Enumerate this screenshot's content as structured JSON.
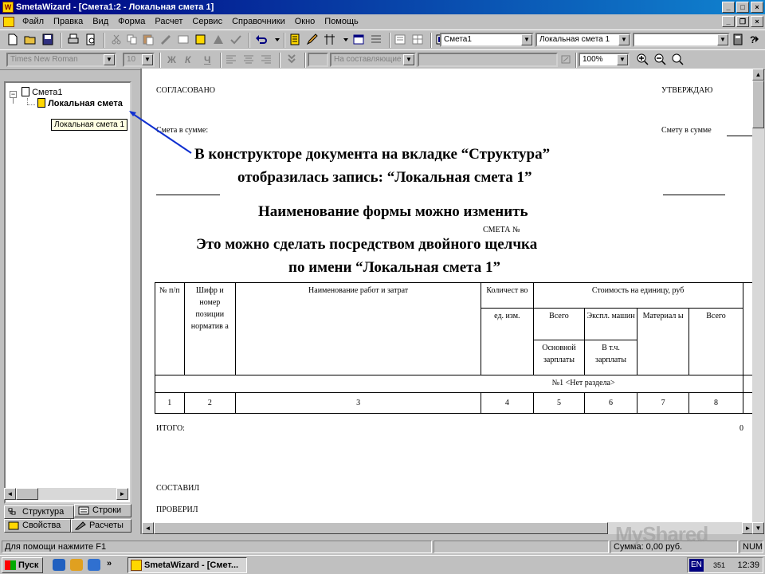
{
  "window": {
    "title": "SmetaWizard - [Смета1:2 - Локальная смета 1]"
  },
  "menu": [
    "Файл",
    "Правка",
    "Вид",
    "Форма",
    "Расчет",
    "Сервис",
    "Справочники",
    "Окно",
    "Помощь"
  ],
  "toolbar1": {
    "combo_estimate": "Смета1",
    "combo_local": "Локальная смета 1",
    "combo_empty": ""
  },
  "toolbar2": {
    "font_name": "Times New Roman",
    "font_size": "10",
    "bold": "Ж",
    "italic": "К",
    "underline": "Ч",
    "align_mode": "На составляющие",
    "zoom": "100%"
  },
  "tree": {
    "root": "Смета1",
    "child": "Локальная смета",
    "tooltip": "Локальная смета 1"
  },
  "left_tabs": {
    "structure": "Структура",
    "rows": "Строки",
    "properties": "Свойства",
    "calculations": "Расчеты"
  },
  "document": {
    "agreed": "СОГЛАСОВАНО",
    "approve": "УТВЕРЖДАЮ",
    "estimate_sum_left": "Смета в сумме:",
    "estimate_sum_right": "Смету в сумме",
    "estimate_no": "СМЕТА №",
    "total_label": "ИТОГО:",
    "total_value": "0",
    "compiled": "СОСТАВИЛ",
    "checked": "ПРОВЕРИЛ"
  },
  "table": {
    "h_no": "№ п/п",
    "h_code": "Шифр и номер позиции норматив а",
    "h_name": "Наименование работ и затрат",
    "h_qty": "Количест во",
    "h_unit": "ед. изм.",
    "h_cost": "Стоимость на единицу, руб",
    "h_total": "Всего",
    "h_machines": "Экспл. машин",
    "h_materials": "Материал ы",
    "h_total2": "Всего",
    "h_base_salary": "Основной зарплаты",
    "h_incl_salary": "В т.ч. зарплаты",
    "section": "№1 <Нет раздела>",
    "numbers": [
      "1",
      "2",
      "3",
      "4",
      "5",
      "6",
      "7",
      "8"
    ]
  },
  "annotations": {
    "line1": "В конструкторе документа на вкладке “Структура”",
    "line2": "отобразилась запись: “Локальная смета 1”",
    "line3": "Наименование формы можно изменить",
    "line4": "Это можно сделать посредством двойного щелчка",
    "line5": "по имени “Локальная смета 1”"
  },
  "statusbar": {
    "help": "Для помощи нажмите F1",
    "sum": "Сумма: 0,00 руб.",
    "num": "NUM"
  },
  "taskbar": {
    "start": "Пуск",
    "task": "SmetaWizard - [Смет...",
    "lang": "EN",
    "tray_num": "351",
    "clock": "12:39"
  },
  "watermark": "MyShared"
}
